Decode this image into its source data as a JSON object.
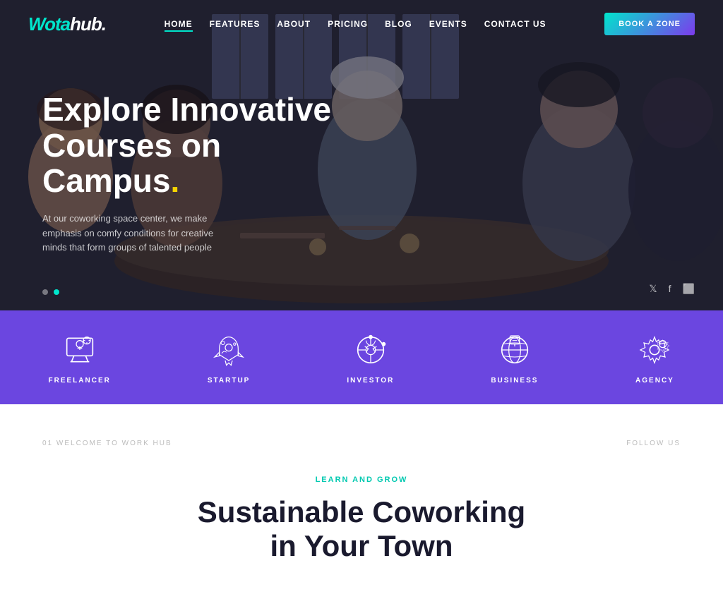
{
  "site": {
    "logo_wota": "Wota",
    "logo_hub": "hub.",
    "logo_dot": ""
  },
  "nav": {
    "links": [
      {
        "label": "HOME",
        "active": true
      },
      {
        "label": "FEATURES",
        "active": false
      },
      {
        "label": "ABOUT",
        "active": false
      },
      {
        "label": "PRICING",
        "active": false
      },
      {
        "label": "BLOG",
        "active": false
      },
      {
        "label": "EVENTS",
        "active": false
      },
      {
        "label": "CONTACT US",
        "active": false
      }
    ],
    "cta_label": "BOOK A ZONE"
  },
  "hero": {
    "title_line1": "Explore Innovative",
    "title_line2": "Courses on Campus",
    "title_dot": ".",
    "description": "At our coworking space center, we make emphasis on comfy conditions for creative minds that form groups of talented people",
    "dots": [
      {
        "active": false
      },
      {
        "active": true
      }
    ],
    "social": [
      {
        "icon": "twitter",
        "symbol": "𝕋"
      },
      {
        "icon": "facebook",
        "symbol": "f"
      },
      {
        "icon": "instagram",
        "symbol": "◻"
      }
    ]
  },
  "features": [
    {
      "label": "FREELANCER",
      "icon": "monitor-icon"
    },
    {
      "label": "STARTUP",
      "icon": "rocket-icon"
    },
    {
      "label": "INVESTOR",
      "icon": "chart-icon"
    },
    {
      "label": "BUSINESS",
      "icon": "globe-icon"
    },
    {
      "label": "AGENCY",
      "icon": "gear-icon"
    }
  ],
  "welcome_section": {
    "left_label": "01 WELCOME TO WORK HUB",
    "right_label": "FOLLOW US",
    "tag": "LEARN AND GROW",
    "title_line1": "Sustainable Coworking",
    "title_line2": "in Your Town"
  }
}
